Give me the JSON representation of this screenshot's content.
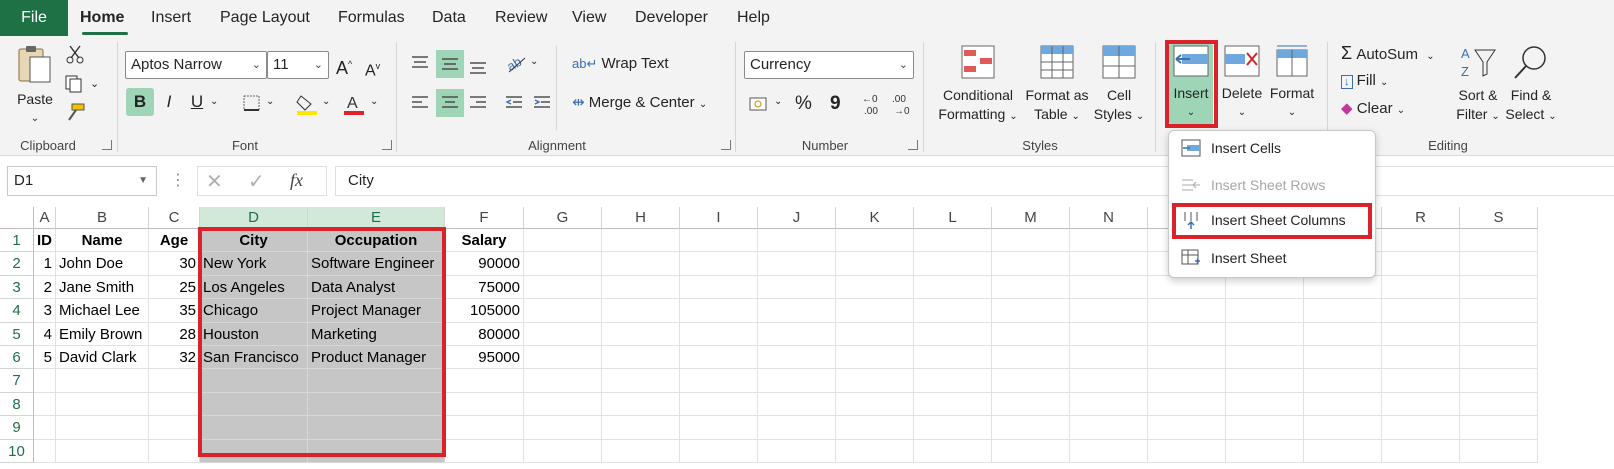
{
  "tabs": {
    "file": "File",
    "home": "Home",
    "insert": "Insert",
    "page_layout": "Page Layout",
    "formulas": "Formulas",
    "data": "Data",
    "review": "Review",
    "view": "View",
    "developer": "Developer",
    "help": "Help"
  },
  "clipboard": {
    "paste": "Paste",
    "label": "Clipboard"
  },
  "font": {
    "name": "Aptos Narrow",
    "size": "11",
    "label": "Font",
    "bold": "B",
    "italic": "I",
    "underline": "U",
    "grow": "A",
    "shrink": "A"
  },
  "alignment": {
    "wrap_text": "Wrap Text",
    "merge_center": "Merge & Center",
    "label": "Alignment"
  },
  "number": {
    "format": "Currency",
    "label": "Number",
    "percent": "%",
    "comma": "9"
  },
  "styles": {
    "conditional_1": "Conditional",
    "conditional_2": "Formatting",
    "format_table_1": "Format as",
    "format_table_2": "Table",
    "cell_styles_1": "Cell",
    "cell_styles_2": "Styles",
    "label": "Styles"
  },
  "cells": {
    "insert": "Insert",
    "delete": "Delete",
    "format": "Format"
  },
  "editing": {
    "autosum": "AutoSum",
    "fill": "Fill",
    "clear": "Clear",
    "sort_1": "Sort &",
    "sort_2": "Filter",
    "find_1": "Find &",
    "find_2": "Select",
    "label": "Editing"
  },
  "insert_menu": {
    "items": [
      "Insert Cells",
      "Insert Sheet Rows",
      "Insert Sheet Columns",
      "Insert Sheet"
    ]
  },
  "formula_bar": {
    "name_box": "D1",
    "fx": "fx",
    "value": "City"
  },
  "grid": {
    "columns": [
      "A",
      "B",
      "C",
      "D",
      "E",
      "F",
      "G",
      "H",
      "I",
      "J",
      "K",
      "L",
      "M",
      "N",
      "O",
      "P",
      "Q",
      "R",
      "S"
    ],
    "rows": [
      "1",
      "2",
      "3",
      "4",
      "5",
      "6",
      "7",
      "8",
      "9",
      "10"
    ],
    "header": [
      "ID",
      "Name",
      "Age",
      "City",
      "Occupation",
      "Salary"
    ],
    "data": [
      [
        "1",
        "John Doe",
        "30",
        "New York",
        "Software Engineer",
        "90000"
      ],
      [
        "2",
        "Jane Smith",
        "25",
        "Los Angeles",
        "Data Analyst",
        "75000"
      ],
      [
        "3",
        "Michael Lee",
        "35",
        "Chicago",
        "Project Manager",
        "105000"
      ],
      [
        "4",
        "Emily Brown",
        "28",
        "Houston",
        "Marketing",
        "80000"
      ],
      [
        "5",
        "David Clark",
        "32",
        "San Francisco",
        "Product Manager",
        "95000"
      ]
    ]
  }
}
